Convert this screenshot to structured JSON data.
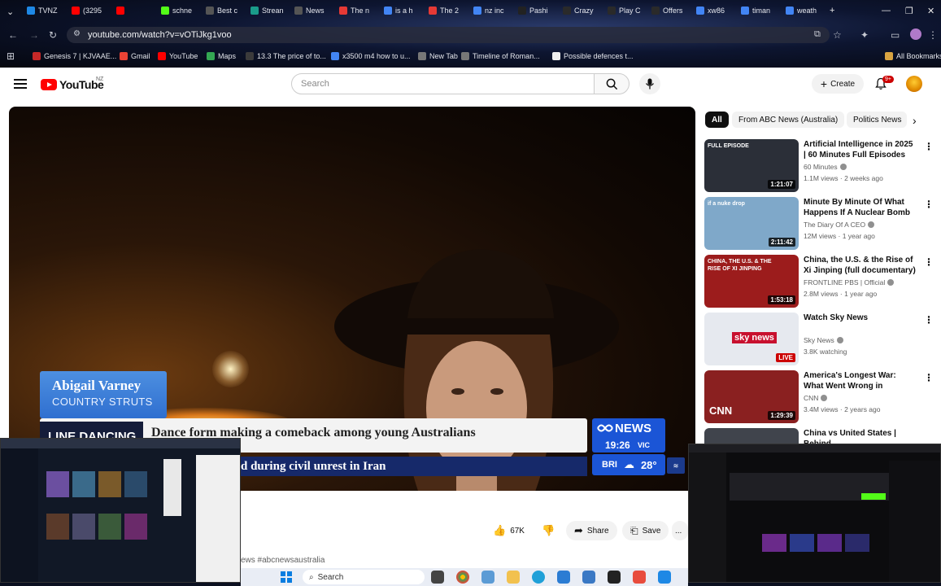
{
  "browser": {
    "tabs": [
      {
        "label": "TVNZ",
        "color": "#1e88e5"
      },
      {
        "label": "(3295",
        "color": "#ff0000"
      },
      {
        "label": "",
        "color": "#ff0000"
      },
      {
        "label": "schne",
        "color": "#53fc18"
      },
      {
        "label": "Best c",
        "color": "#555555"
      },
      {
        "label": "Strean",
        "color": "#1a9c8a"
      },
      {
        "label": "News",
        "color": "#555555"
      },
      {
        "label": "The n",
        "color": "#e53935"
      },
      {
        "label": "is a h",
        "color": "#4285f4"
      },
      {
        "label": "The 2",
        "color": "#e53935"
      },
      {
        "label": "nz inc",
        "color": "#4285f4"
      },
      {
        "label": "Pashi",
        "color": "#222222"
      },
      {
        "label": "Crazy",
        "color": "#2a2a2a"
      },
      {
        "label": "Play C",
        "color": "#2a2a2a"
      },
      {
        "label": "Offers",
        "color": "#2a2a2a"
      },
      {
        "label": "xw86",
        "color": "#4285f4"
      },
      {
        "label": "timan",
        "color": "#4285f4"
      },
      {
        "label": "weath",
        "color": "#4285f4"
      }
    ],
    "new_tab": "+",
    "url": "youtube.com/watch?v=vOTiJkg1voo",
    "bookmarks": [
      {
        "label": "Genesis 7 | KJVAAE...",
        "color": "#c62828"
      },
      {
        "label": "Gmail",
        "color": "#ea4335"
      },
      {
        "label": "YouTube",
        "color": "#ff0000"
      },
      {
        "label": "Maps",
        "color": "#34a853"
      },
      {
        "label": "13.3 The price of to...",
        "color": "#3b3b3b"
      },
      {
        "label": "x3500 m4 how to u...",
        "color": "#4285f4"
      },
      {
        "label": "New Tab",
        "color": "#777777"
      },
      {
        "label": "Timeline of Roman...",
        "color": "#777777"
      },
      {
        "label": "Possible defences t...",
        "color": "#eeeeee"
      }
    ],
    "all_bookmarks": "All Bookmarks"
  },
  "youtube": {
    "logo_text": "YouTube",
    "country_code": "NZ",
    "search_placeholder": "Search",
    "create_label": "Create",
    "notifications_badge": "9+"
  },
  "video": {
    "name_card_name": "Abigail Varney",
    "name_card_role": "COUNTRY STRUTS",
    "ticker_label": "LINE DANCING",
    "headline": "Dance form making a comeback among young Australians",
    "ticker_secondary": "d during civil unrest in Iran",
    "channel_logo": "NEWS",
    "time": "19:26",
    "tz": "VIC",
    "city": "BRI",
    "temp": "28°"
  },
  "actions": {
    "likes": "67K",
    "share": "Share",
    "save": "Save",
    "more": "..."
  },
  "description_tail": "ews #abcnewsaustralia",
  "chips": [
    "All",
    "From ABC News (Australia)",
    "Politics News"
  ],
  "recommendations": [
    {
      "title": "Artificial Intelligence in 2025 | 60 Minutes Full Episodes",
      "channel": "60 Minutes",
      "meta": "1.1M views · 2 weeks ago",
      "duration": "1:21:07",
      "badge": "FULL EPISODE",
      "thumb_color": "#2b2f38"
    },
    {
      "title": "Minute By Minute Of What Happens If A Nuclear Bomb ...",
      "channel": "The Diary Of A CEO",
      "meta": "12M views · 1 year ago",
      "duration": "2:11:42",
      "badge": "if a nuke drop",
      "thumb_color": "#7fa8c9"
    },
    {
      "title": "China, the U.S. & the Rise of Xi Jinping (full documentary) | ...",
      "channel": "FRONTLINE PBS | Official",
      "meta": "2.8M views · 1 year ago",
      "duration": "1:53:18",
      "badge": "CHINA, THE U.S. & THE RISE OF XI JINPING",
      "thumb_color": "#9c1c1c"
    },
    {
      "title": "Watch Sky News",
      "channel": "Sky News",
      "meta": "3.8K watching",
      "duration": "LIVE",
      "badge": "sky news",
      "thumb_color": "#e6e9ef"
    },
    {
      "title": "America's Longest War: What Went Wrong in Afghanistan ...",
      "channel": "CNN",
      "meta": "3.4M views · 2 years ago",
      "duration": "1:29:39",
      "badge": "CNN",
      "thumb_color": "#8a2020"
    },
    {
      "title": "China vs United States | Behind",
      "channel": "",
      "meta": "",
      "duration": "",
      "badge": "",
      "thumb_color": "#40444c"
    }
  ],
  "taskbar": {
    "search_label": "Search"
  }
}
